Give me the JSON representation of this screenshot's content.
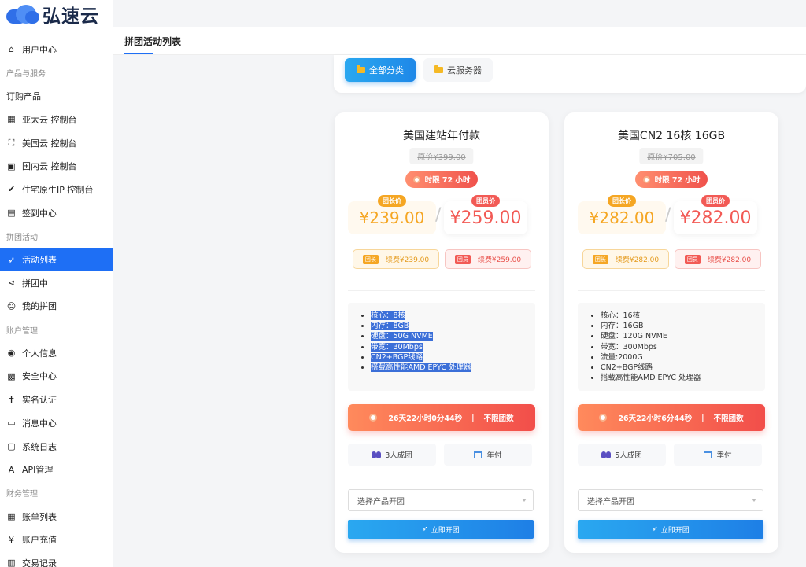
{
  "app": {
    "logo_text": "弘速云"
  },
  "sidebar": {
    "items": [
      {
        "label": "用户中心",
        "type": "item",
        "icon": "home-icon",
        "glyph": "⌂"
      },
      {
        "label": "产品与服务",
        "type": "section"
      },
      {
        "label": "订购产品",
        "type": "plain"
      },
      {
        "label": "亚太云 控制台",
        "type": "item",
        "icon": "qr-icon",
        "glyph": "▦"
      },
      {
        "label": "美国云 控制台",
        "type": "item",
        "icon": "frame-icon",
        "glyph": "⛶"
      },
      {
        "label": "国内云 控制台",
        "type": "item",
        "icon": "box-icon",
        "glyph": "▣"
      },
      {
        "label": "住宅原生IP 控制台",
        "type": "item",
        "icon": "check-circle-icon",
        "glyph": "✔"
      },
      {
        "label": "签到中心",
        "type": "item",
        "icon": "calendar-icon",
        "glyph": "▤"
      },
      {
        "label": "拼团活动",
        "type": "section"
      },
      {
        "label": "活动列表",
        "type": "active",
        "icon": "rocket-icon",
        "glyph": "➶"
      },
      {
        "label": "拼团中",
        "type": "item",
        "icon": "share-icon",
        "glyph": "⋖"
      },
      {
        "label": "我的拼团",
        "type": "item",
        "icon": "user-icon",
        "glyph": "☺"
      },
      {
        "label": "账户管理",
        "type": "section"
      },
      {
        "label": "个人信息",
        "type": "item",
        "icon": "location-icon",
        "glyph": "◉"
      },
      {
        "label": "安全中心",
        "type": "item",
        "icon": "briefcase-icon",
        "glyph": "▩"
      },
      {
        "label": "实名认证",
        "type": "item",
        "icon": "person-icon",
        "glyph": "✝"
      },
      {
        "label": "消息中心",
        "type": "item",
        "icon": "chat-icon",
        "glyph": "▭"
      },
      {
        "label": "系统日志",
        "type": "item",
        "icon": "robot-icon",
        "glyph": "▢"
      },
      {
        "label": "API管理",
        "type": "item",
        "icon": "api-icon",
        "glyph": "A"
      },
      {
        "label": "财务管理",
        "type": "section"
      },
      {
        "label": "账单列表",
        "type": "item",
        "icon": "table-icon",
        "glyph": "▦"
      },
      {
        "label": "账户充值",
        "type": "item",
        "icon": "yen-icon",
        "glyph": "¥"
      },
      {
        "label": "交易记录",
        "type": "item",
        "icon": "record-icon",
        "glyph": "▥"
      }
    ]
  },
  "header": {
    "tab_label": "拼团活动列表"
  },
  "categories": {
    "all": "全部分类",
    "cloud": "云服务器"
  },
  "cards": [
    {
      "title": "美国建站年付款",
      "original_price": "原价¥399.00",
      "limit": "时限 72 小时",
      "lead_tag": "团长价",
      "lead_price": "¥239.00",
      "member_tag": "团员价",
      "member_price": "¥259.00",
      "renew_lead_tag": "团长",
      "renew_lead": "续费¥239.00",
      "renew_member_tag": "团员",
      "renew_member": "续费¥259.00",
      "specs": [
        "核心：8核",
        "内存：8GB",
        "硬盘：50G NVME",
        "带宽：30Mbps",
        "CN2+BGP线路",
        "搭载高性能AMD EPYC 处理器"
      ],
      "timer": "26天22小时0分44秒",
      "timer_note": "不限团数",
      "group_size": "3人成团",
      "billing": "年付",
      "select_placeholder": "选择产品开团",
      "open_label": "立即开团"
    },
    {
      "title": "美国CN2 16核 16GB",
      "original_price": "原价¥705.00",
      "limit": "时限 72 小时",
      "lead_tag": "团长价",
      "lead_price": "¥282.00",
      "member_tag": "团员价",
      "member_price": "¥282.00",
      "renew_lead_tag": "团长",
      "renew_lead": "续费¥282.00",
      "renew_member_tag": "团员",
      "renew_member": "续费¥282.00",
      "specs": [
        "核心：16核",
        "内存：16GB",
        "硬盘：120G NVME",
        "带宽：300Mbps",
        "流量:2000G",
        "CN2+BGP线路",
        "搭载高性能AMD EPYC 处理器"
      ],
      "timer": "26天22小时6分44秒",
      "timer_note": "不限团数",
      "group_size": "5人成团",
      "billing": "季付",
      "select_placeholder": "选择产品开团",
      "open_label": "立即开团"
    }
  ]
}
